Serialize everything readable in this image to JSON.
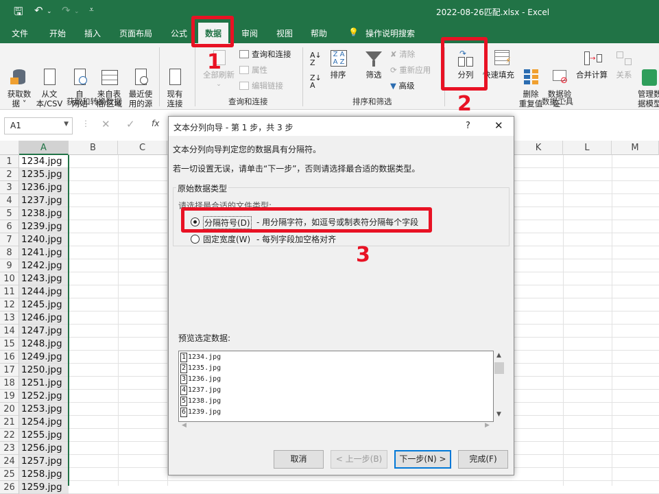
{
  "window": {
    "title": "2022-08-26匹配.xlsx  -  Excel"
  },
  "tabs": [
    "文件",
    "开始",
    "插入",
    "页面布局",
    "公式",
    "数据",
    "审阅",
    "视图",
    "帮助"
  ],
  "tell_me": "操作说明搜索",
  "ribbon": {
    "get_data": "获取数\n据 ˅",
    "from_text": "从文\n本/CSV",
    "from_web": "自\n网站",
    "from_table": "来自表\n格/区域",
    "recent": "最近使\n用的源",
    "existing": "现有\n连接",
    "group_get": "获取和转换数据",
    "refresh_all": "全部刷新",
    "queries": "查询和连接",
    "properties": "属性",
    "edit_links": "编辑链接",
    "group_query": "查询和连接",
    "sort": "排序",
    "filter": "筛选",
    "clear": "清除",
    "reapply": "重新应用",
    "advanced": "高级",
    "group_sort": "排序和筛选",
    "text_to_columns": "分列",
    "flash_fill": "快速填充",
    "remove_dup": "删除\n重复值",
    "validation": "数据验\n证 ˅",
    "consolidate": "合并计算",
    "relations": "关系",
    "manage_model": "管理数\n据模型",
    "group_tools": "数据工具"
  },
  "formula_bar": {
    "name_box": "A1",
    "fx": "fx"
  },
  "columns_left": [
    "A",
    "B",
    "C"
  ],
  "columns_right": [
    "K",
    "L",
    "M"
  ],
  "rows": [
    "1",
    "2",
    "3",
    "4",
    "5",
    "6",
    "7",
    "8",
    "9",
    "10",
    "11",
    "12",
    "13",
    "14",
    "15",
    "16",
    "17",
    "18",
    "19",
    "20",
    "21",
    "22",
    "23",
    "24",
    "25",
    "26"
  ],
  "cells": [
    "1234.jpg",
    "1235.jpg",
    "1236.jpg",
    "1237.jpg",
    "1238.jpg",
    "1239.jpg",
    "1240.jpg",
    "1241.jpg",
    "1242.jpg",
    "1243.jpg",
    "1244.jpg",
    "1245.jpg",
    "1246.jpg",
    "1247.jpg",
    "1248.jpg",
    "1249.jpg",
    "1250.jpg",
    "1251.jpg",
    "1252.jpg",
    "1253.jpg",
    "1254.jpg",
    "1255.jpg",
    "1256.jpg",
    "1257.jpg",
    "1258.jpg",
    "1259.jpg"
  ],
  "dialog": {
    "title": "文本分列向导 - 第 1 步，共 3 步",
    "help": "?",
    "line1": "文本分列向导判定您的数据具有分隔符。",
    "line2": "若一切设置无误，请单击“下一步”，否则请选择最合适的数据类型。",
    "group_label": "原始数据类型",
    "choose_label": "请选择最合适的文件类型:",
    "opt_delimited": "分隔符号(D)",
    "opt_delimited_desc": "- 用分隔字符，如逗号或制表符分隔每个字段",
    "opt_fixed": "固定宽度(W)",
    "opt_fixed_desc": "- 每列字段加空格对齐",
    "preview_label": "预览选定数据:",
    "preview_rows": [
      {
        "n": "1",
        "t": "1234.jpg"
      },
      {
        "n": "2",
        "t": "1235.jpg"
      },
      {
        "n": "3",
        "t": "1236.jpg"
      },
      {
        "n": "4",
        "t": "1237.jpg"
      },
      {
        "n": "5",
        "t": "1238.jpg"
      },
      {
        "n": "6",
        "t": "1239.jpg"
      }
    ],
    "btn_cancel": "取消",
    "btn_back": "< 上一步(B)",
    "btn_next": "下一步(N) >",
    "btn_finish": "完成(F)"
  },
  "annotations": [
    "1",
    "2",
    "3"
  ],
  "colors": {
    "excel_green": "#217346",
    "highlight_red": "#e81224",
    "focus_blue": "#0078d7"
  }
}
